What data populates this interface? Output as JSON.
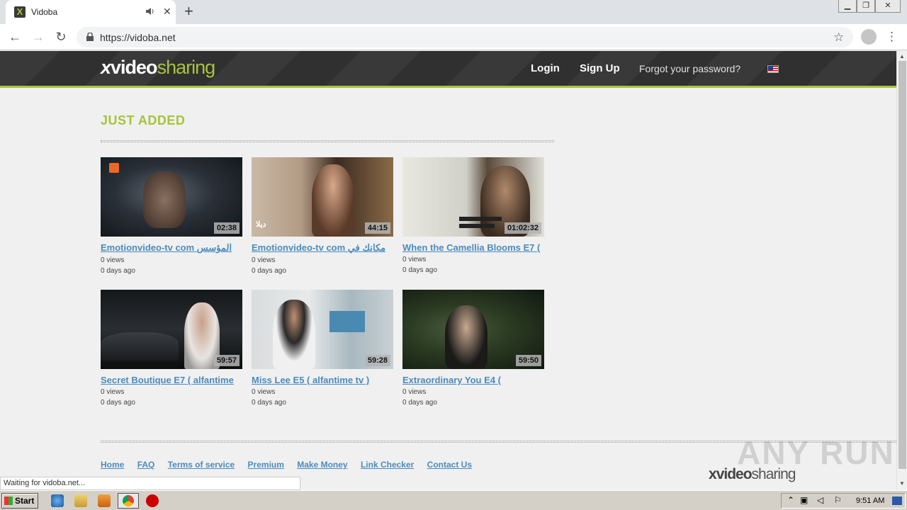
{
  "browser": {
    "tab_title": "Vidoba",
    "favicon_letter": "X",
    "close_tab": "✕",
    "new_tab": "+",
    "url": "https://vidoba.net",
    "status": "Waiting for vidoba.net..."
  },
  "site": {
    "logo": {
      "x": "x",
      "video": "video",
      "sharing": "sharing"
    },
    "nav": {
      "login": "Login",
      "signup": "Sign Up",
      "forgot": "Forgot your password?"
    },
    "section_title": "JUST ADDED",
    "videos": [
      {
        "title": "Emotionvideo-tv com المؤسس",
        "duration": "02:38",
        "views": "0 views",
        "age": "0 days ago"
      },
      {
        "title": "Emotionvideo-tv com مكانك في",
        "duration": "44:15",
        "views": "0 views",
        "age": "0 days ago"
      },
      {
        "title": "When the Camellia Blooms E7 (",
        "duration": "01:02:32",
        "views": "0 views",
        "age": "0 days ago"
      },
      {
        "title": "Secret Boutique E7 ( alfantime",
        "duration": "59:57",
        "views": "0 views",
        "age": "0 days ago"
      },
      {
        "title": "Miss Lee E5 ( alfantime tv )",
        "duration": "59:28",
        "views": "0 views",
        "age": "0 days ago"
      },
      {
        "title": "Extraordinary You E4 (",
        "duration": "59:50",
        "views": "0 views",
        "age": "0 days ago"
      }
    ],
    "footer": {
      "links": [
        "Home",
        "FAQ",
        "Terms of service",
        "Premium",
        "Make Money",
        "Link Checker",
        "Contact Us"
      ],
      "logo_x": "x",
      "logo_video": "video",
      "logo_sharing": "sharing"
    }
  },
  "watermark": "ANY RUN",
  "taskbar": {
    "start": "Start",
    "clock": "9:51 AM"
  },
  "colors": {
    "accent": "#a7c33b",
    "link": "#4b8bbe",
    "header": "#333333"
  }
}
